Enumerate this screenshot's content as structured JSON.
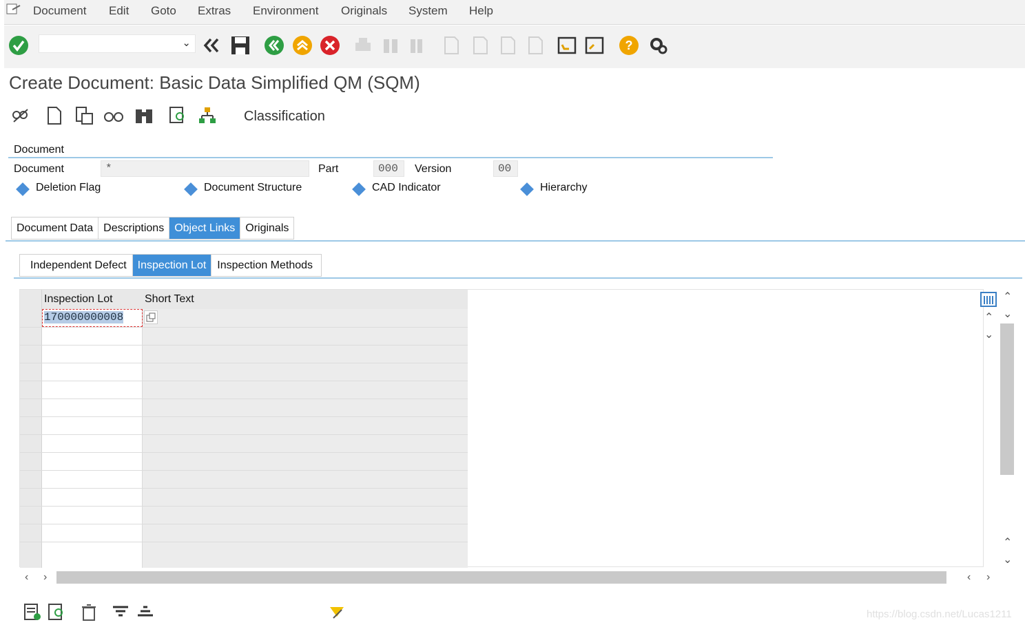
{
  "menu": [
    "Document",
    "Edit",
    "Goto",
    "Extras",
    "Environment",
    "Originals",
    "System",
    "Help"
  ],
  "toolbar": {
    "command_value": "",
    "icons": [
      "enter-icon",
      "back-double-icon",
      "save-icon",
      "back-icon",
      "exit-icon",
      "cancel-icon",
      "print-icon",
      "find-icon",
      "find-next-icon",
      "first-page-icon",
      "previous-page-icon",
      "next-page-icon",
      "last-page-icon",
      "create-session-icon",
      "generate-shortcut-icon",
      "help-icon",
      "settings-icon"
    ]
  },
  "title": "Create Document: Basic Data Simplified QM (SQM)",
  "app_toolbar": {
    "classification": "Classification"
  },
  "document_group": {
    "title": "Document",
    "document_label": "Document",
    "document_value": "*",
    "part_label": "Part",
    "part_value": "000",
    "version_label": "Version",
    "version_value": "00",
    "flags": [
      "Deletion Flag",
      "Document Structure",
      "CAD Indicator",
      "Hierarchy"
    ],
    "flag_color": "#4a8fd8"
  },
  "main_tabs": {
    "items": [
      "Document Data",
      "Descriptions",
      "Object Links",
      "Originals"
    ],
    "active": "Object Links"
  },
  "sub_tabs": {
    "items": [
      "Independent Defect",
      "Inspection Lot",
      "Inspection Methods"
    ],
    "active": "Inspection Lot"
  },
  "table": {
    "headers": [
      "Inspection Lot",
      "Short Text"
    ],
    "rows": [
      {
        "lot": "170000000008",
        "short_text": ""
      }
    ]
  },
  "watermark": "https://blog.csdn.net/Lucas1211",
  "colors": {
    "accent": "#3f8fd8",
    "line": "#9cc8e6"
  }
}
